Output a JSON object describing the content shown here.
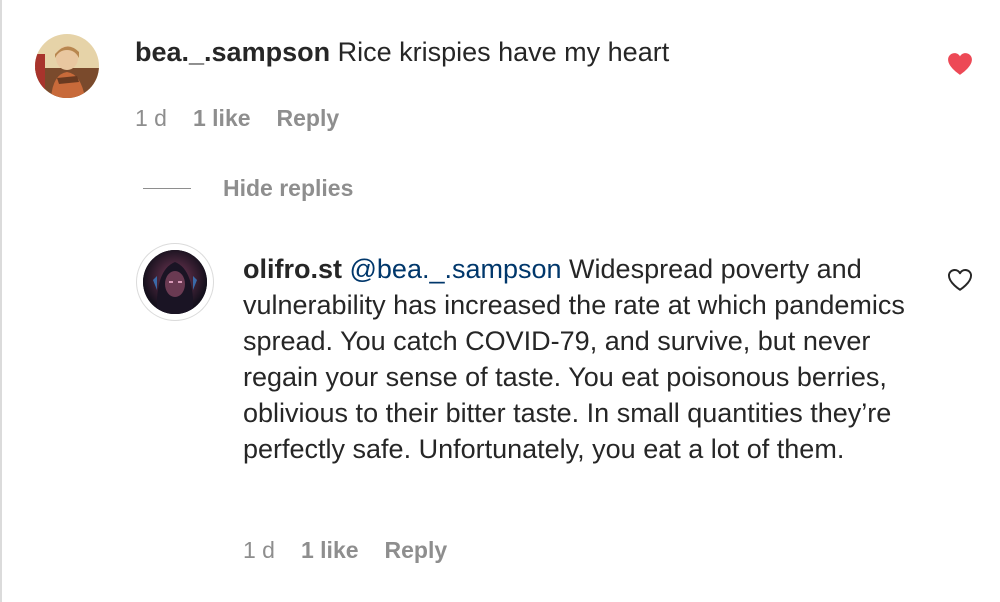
{
  "comments": [
    {
      "username": "bea._.sampson",
      "text": " Rice krispies have my heart",
      "time": "1 d",
      "likes": "1 like",
      "reply_label": "Reply",
      "liked": true,
      "heart_color": "#ed4956",
      "avatar_icon": "profile-photo"
    }
  ],
  "thread": {
    "hide_replies_label": "Hide replies"
  },
  "replies": [
    {
      "username": "olifro.st",
      "mention": " @bea._.sampson",
      "text": " Widespread poverty and vulnerability has increased the rate at which pandemics spread. You catch COVID-79, and survive, but never regain your sense of taste. You eat poisonous berries, oblivious to their bitter taste. In small quantities they’re perfectly safe. Unfortunately, you eat a lot of them.",
      "time": "1 d",
      "likes": "1 like",
      "reply_label": "Reply",
      "liked": false,
      "avatar_icon": "profile-photo",
      "mention_color": "#00376b"
    }
  ],
  "colors": {
    "text_primary": "#262626",
    "text_secondary": "#8e8e8e",
    "like_red": "#ed4956"
  }
}
